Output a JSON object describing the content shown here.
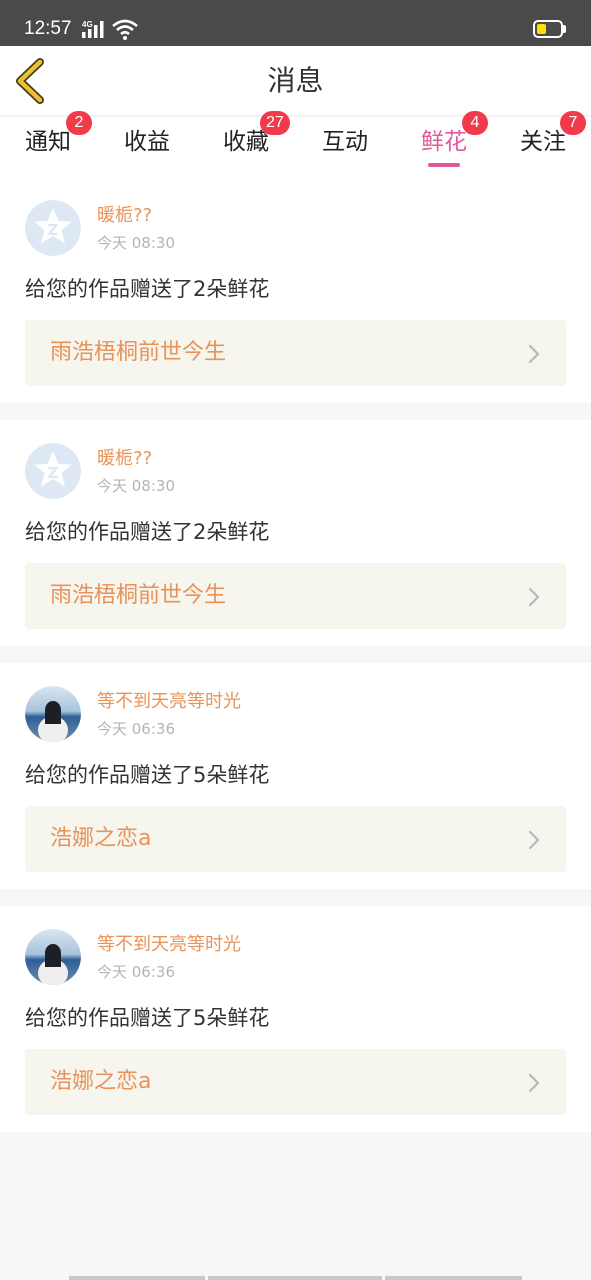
{
  "status_bar": {
    "time": "12:57",
    "network": "4G",
    "battery_level": 0.25
  },
  "header": {
    "title": "消息"
  },
  "tabs": [
    {
      "label": "通知",
      "badge": "2",
      "active": false
    },
    {
      "label": "收益",
      "badge": "",
      "active": false
    },
    {
      "label": "收藏",
      "badge": "27",
      "active": false
    },
    {
      "label": "互动",
      "badge": "",
      "active": false
    },
    {
      "label": "鲜花",
      "badge": "4",
      "active": true
    },
    {
      "label": "关注",
      "badge": "7",
      "active": false
    }
  ],
  "messages": [
    {
      "user": "暖栀??",
      "time": "今天 08:30",
      "text": "给您的作品赠送了2朵鲜花",
      "work": "雨浩梧桐前世今生",
      "avatar": "default-avatar-icon"
    },
    {
      "user": "暖栀??",
      "time": "今天 08:30",
      "text": "给您的作品赠送了2朵鲜花",
      "work": "雨浩梧桐前世今生",
      "avatar": "default-avatar-icon"
    },
    {
      "user": "等不到天亮等时光",
      "time": "今天 06:36",
      "text": "给您的作品赠送了5朵鲜花",
      "work": "浩娜之恋a",
      "avatar": "photo-avatar"
    },
    {
      "user": "等不到天亮等时光",
      "time": "今天 06:36",
      "text": "给您的作品赠送了5朵鲜花",
      "work": "浩娜之恋a",
      "avatar": "photo-avatar"
    }
  ],
  "colors": {
    "accent_pink": "#e05a9b",
    "badge_red": "#f13a4a",
    "name_orange": "#e8935a",
    "link_bg": "#f6f5ee",
    "back_arrow": "#e8c13a"
  }
}
